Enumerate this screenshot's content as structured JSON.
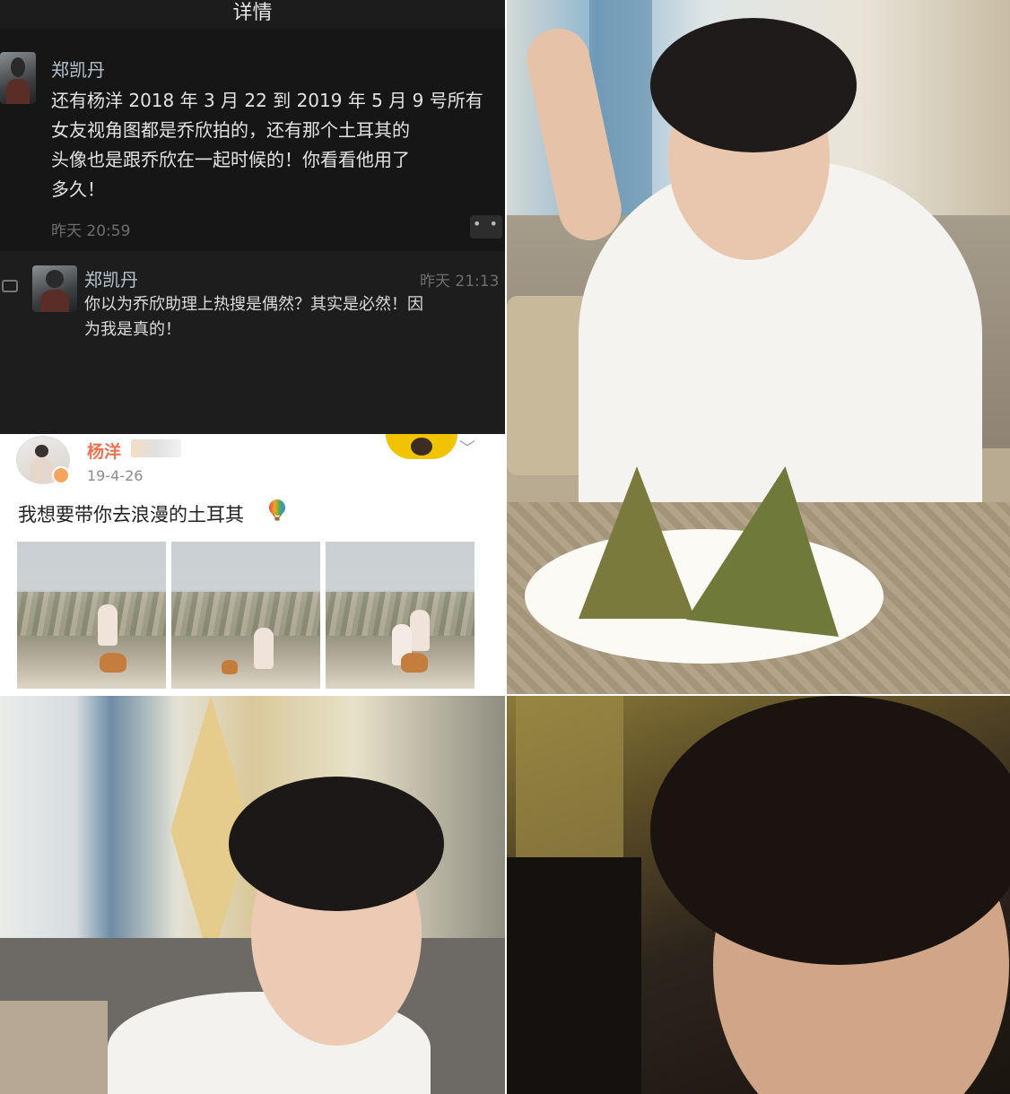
{
  "comment_screen": {
    "title": "详情",
    "comment": {
      "author": "郑凯丹",
      "lines": [
        "还有杨洋 2018 年 3 月 22 到 2019 年 5 月 9 号所有",
        "女友视角图都是乔欣拍的，还有那个土耳其的",
        "头像也是跟乔欣在一起时候的！你看看他用了",
        "多久！"
      ],
      "time": "昨天 20:59",
      "more_label": "• •"
    },
    "reply": {
      "author": "郑凯丹",
      "time": "昨天 21:13",
      "lines": [
        "你以为乔欣助理上热搜是偶然？其实是必然！因",
        "为我是真的！"
      ]
    }
  },
  "weibo_post": {
    "author": "杨洋",
    "date": "19-4-26",
    "text": "我想要带你去浪漫的土耳其",
    "chevron": "﹀",
    "photo_count": 3
  },
  "icons": {
    "reply": "comment-bubble-icon",
    "balloon": "hot-air-balloon-icon",
    "more": "more-dots-icon"
  },
  "colors": {
    "dark_bg": "#161616",
    "weibo_name": "#eb7350",
    "link_blue_gray": "#b7c3cf"
  }
}
